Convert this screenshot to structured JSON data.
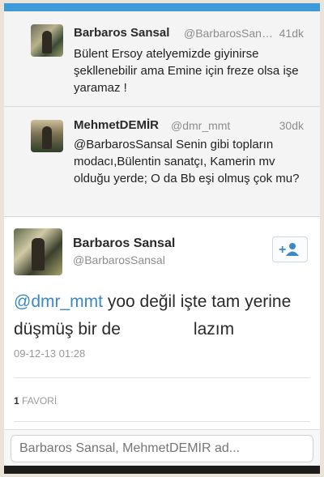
{
  "colors": {
    "accent": "#3b88c3",
    "topbar": "#3e9ad8"
  },
  "tweets": [
    {
      "name": "Barbaros Sansal",
      "handle": "@BarbarosSansal",
      "time": "41dk",
      "text": "Bülent Ersoy atelyemizde giyinirse şekllenebilir ama Emine için freze olsa işe yaramaz !"
    },
    {
      "name": "MehmetDEMİR",
      "handle": "@dmr_mmt",
      "time": "30dk",
      "text": "@BarbarosSansal Senin gibi topların modacı,Bülentin sanatçı, Kamerin mv olduğu yerde; O da Bb eşi olmuş çok mu?"
    }
  ],
  "detail": {
    "name": "Barbaros Sansal",
    "handle": "@BarbarosSansal",
    "mention": "@dmr_mmt",
    "text_part1": " yoo değil işte tam yerine düşmüş bir de",
    "text_part2": "lazım",
    "timestamp": "09-12-13 01:28",
    "fav_count": "1",
    "fav_label": "FAVORİ",
    "follow_icon": "add-user-icon"
  },
  "reply": {
    "placeholder": "Barbaros Sansal, MehmetDEMİR ad..."
  }
}
